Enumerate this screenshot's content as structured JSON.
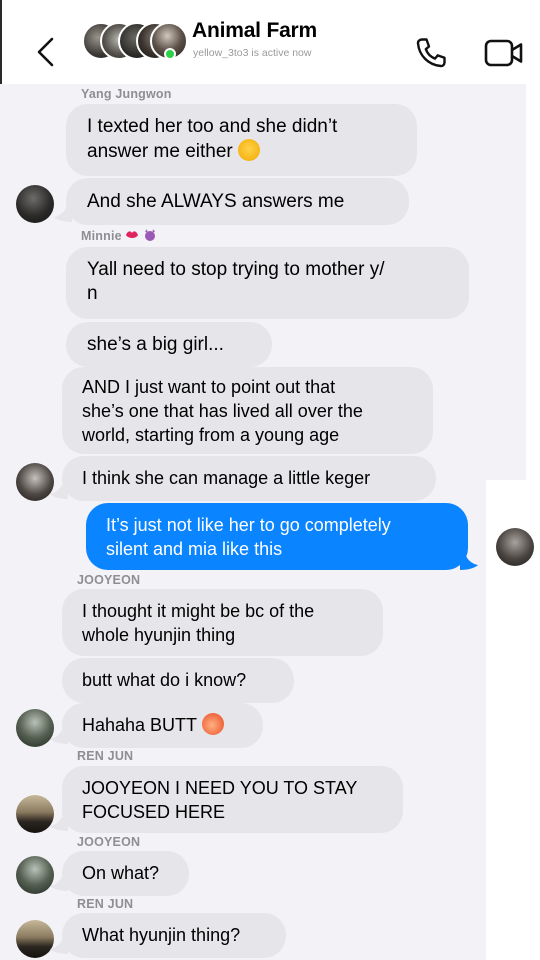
{
  "header": {
    "title": "Animal Farm",
    "status": "yellow_3to3 is active now"
  },
  "colors": {
    "incoming_bubble": "#e5e5ea",
    "outgoing_bubble": "#0a84ff",
    "active_dot": "#2bd147",
    "sender_label": "#8e8e93"
  },
  "messages": {
    "m1_sender": "Yang Jungwon",
    "m1_line1": "I texted her too and she didn’t",
    "m1_line2": "answer me either",
    "m2": "And she ALWAYS answers me",
    "m3_sender": "Minnie",
    "m3_line1": "Yall need to stop trying to mother y/",
    "m3_line2": "n",
    "m4": "she’s a big girl...",
    "m5_line1": "AND I just want to point out that",
    "m5_line2": "she’s one that has lived all over the",
    "m5_line3": "world, starting from a young age",
    "m6": "I think she can manage a little keger",
    "m7_line1": "It’s just not like her to go completely",
    "m7_line2": "silent and mia like this",
    "m8_sender": "JOOYEON",
    "m8_line1": "I thought it might be bc of the",
    "m8_line2": "whole hyunjin thing",
    "m9": "butt what do i know?",
    "m10": "Hahaha BUTT",
    "m11_sender": "REN JUN",
    "m11_line1": "JOOYEON I NEED YOU TO STAY",
    "m11_line2": "FOCUSED HERE",
    "m12_sender": "JOOYEON",
    "m12": "On what?",
    "m13_sender": "REN JUN",
    "m13": "What hyunjin thing?"
  }
}
